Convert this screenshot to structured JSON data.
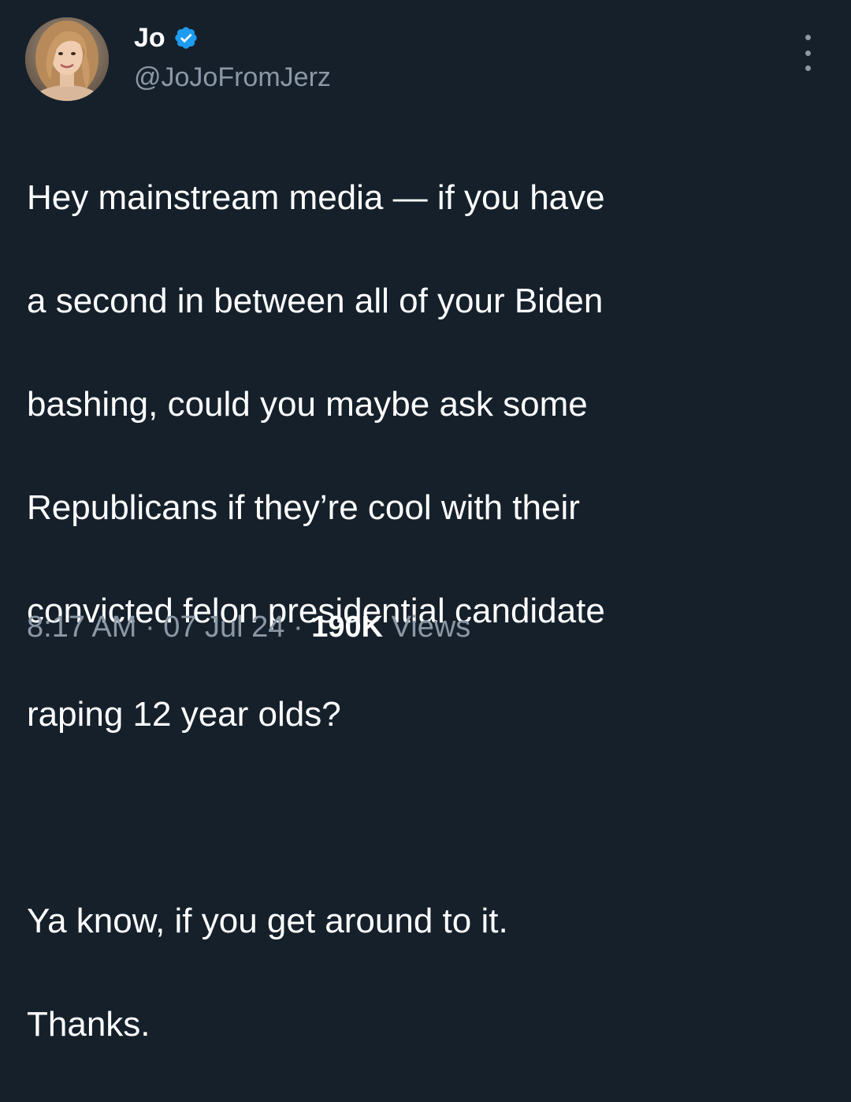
{
  "author": {
    "display_name": "Jo",
    "handle": "@JoJoFromJerz",
    "verified_icon": "verified-badge-icon",
    "avatar_icon": "profile-photo"
  },
  "more_icon": "more-options-icon",
  "tweet": {
    "lines": [
      "Hey mainstream media — if you have",
      "a second in between all of your Biden",
      "bashing, could you maybe ask some",
      "Republicans if they’re cool with their",
      "convicted felon presidential candidate",
      "raping 12 year olds?",
      "",
      "Ya know, if you get around to it.",
      "Thanks."
    ]
  },
  "meta": {
    "time": "8:17 AM",
    "date": "07 Jul 24",
    "views_count": "190K",
    "views_label": "Views",
    "separator": " · "
  },
  "colors": {
    "background": "#15202b",
    "text_primary": "#ffffff",
    "text_secondary": "#8b98a5",
    "verified_blue": "#1d9bf0"
  }
}
